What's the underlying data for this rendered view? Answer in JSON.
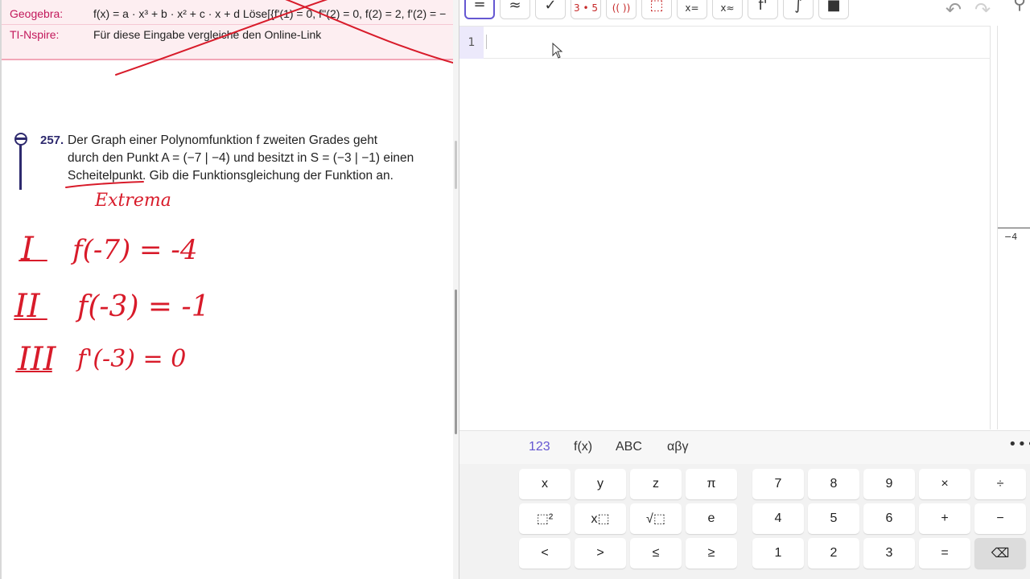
{
  "document": {
    "tech_box": {
      "geogebra": {
        "tool": "Geogebra:",
        "command": "f(x) = a · x³ + b · x² + c · x + d     Löse[{f'(1) = 0, f''(2) = 0, f(2) = 2, f'(2) = −"
      },
      "nspire": {
        "tool": "TI-Nspire:",
        "command": "Für diese Eingabe vergleiche den Online-Link"
      }
    },
    "exercise": {
      "number": "257.",
      "line1": "Der Graph einer Polynomfunktion f zweiten Grades geht",
      "line2": "durch den Punkt A = (−7 | −4) und besitzt in S = (−3 | −1) einen",
      "line3": "Scheitelpunkt. Gib die Funktionsgleichung der Funktion an."
    },
    "handwriting": {
      "note": "Extrema",
      "eq1_label": "I",
      "eq1": "f(-7) = -4",
      "eq2_label": "II",
      "eq2": "f(-3) = -1",
      "eq3_label": "III",
      "eq3": "f'(-3) = 0"
    },
    "ink_color": "#d81b2a"
  },
  "calculator": {
    "toolbar": {
      "buttons": [
        {
          "label": "=",
          "name": "equals-mode-button"
        },
        {
          "label": "≈",
          "name": "approx-mode-button"
        },
        {
          "label": "✓",
          "name": "check-button"
        },
        {
          "label": "3 • 5",
          "name": "factor-button"
        },
        {
          "label": "(( ))",
          "name": "expand-button"
        },
        {
          "label": "⬚",
          "name": "substitute-button"
        },
        {
          "label": "x=",
          "name": "solve-button"
        },
        {
          "label": "x≈",
          "name": "nsolve-button"
        },
        {
          "label": "f'",
          "name": "derivative-button"
        },
        {
          "label": "∫",
          "name": "integral-button"
        },
        {
          "label": "■",
          "name": "delete-button"
        }
      ],
      "undo": "↶",
      "redo": "↷",
      "search": "⚲"
    },
    "cas": {
      "row_number": "1"
    },
    "graph": {
      "axis_label": "−4"
    },
    "keyboard_tabs": [
      "123",
      "f(x)",
      "ABC",
      "αβγ"
    ],
    "keyboard_more": "•••",
    "keys_left": [
      [
        "x",
        "y",
        "z",
        "π"
      ],
      [
        "⬚²",
        "x⬚",
        "√⬚",
        "e"
      ],
      [
        "<",
        ">",
        "≤",
        "≥"
      ]
    ],
    "keys_right": [
      [
        "7",
        "8",
        "9",
        "×",
        "÷"
      ],
      [
        "4",
        "5",
        "6",
        "+",
        "−"
      ],
      [
        "1",
        "2",
        "3",
        "=",
        "⌫"
      ]
    ],
    "accent_color": "#6557d2"
  }
}
